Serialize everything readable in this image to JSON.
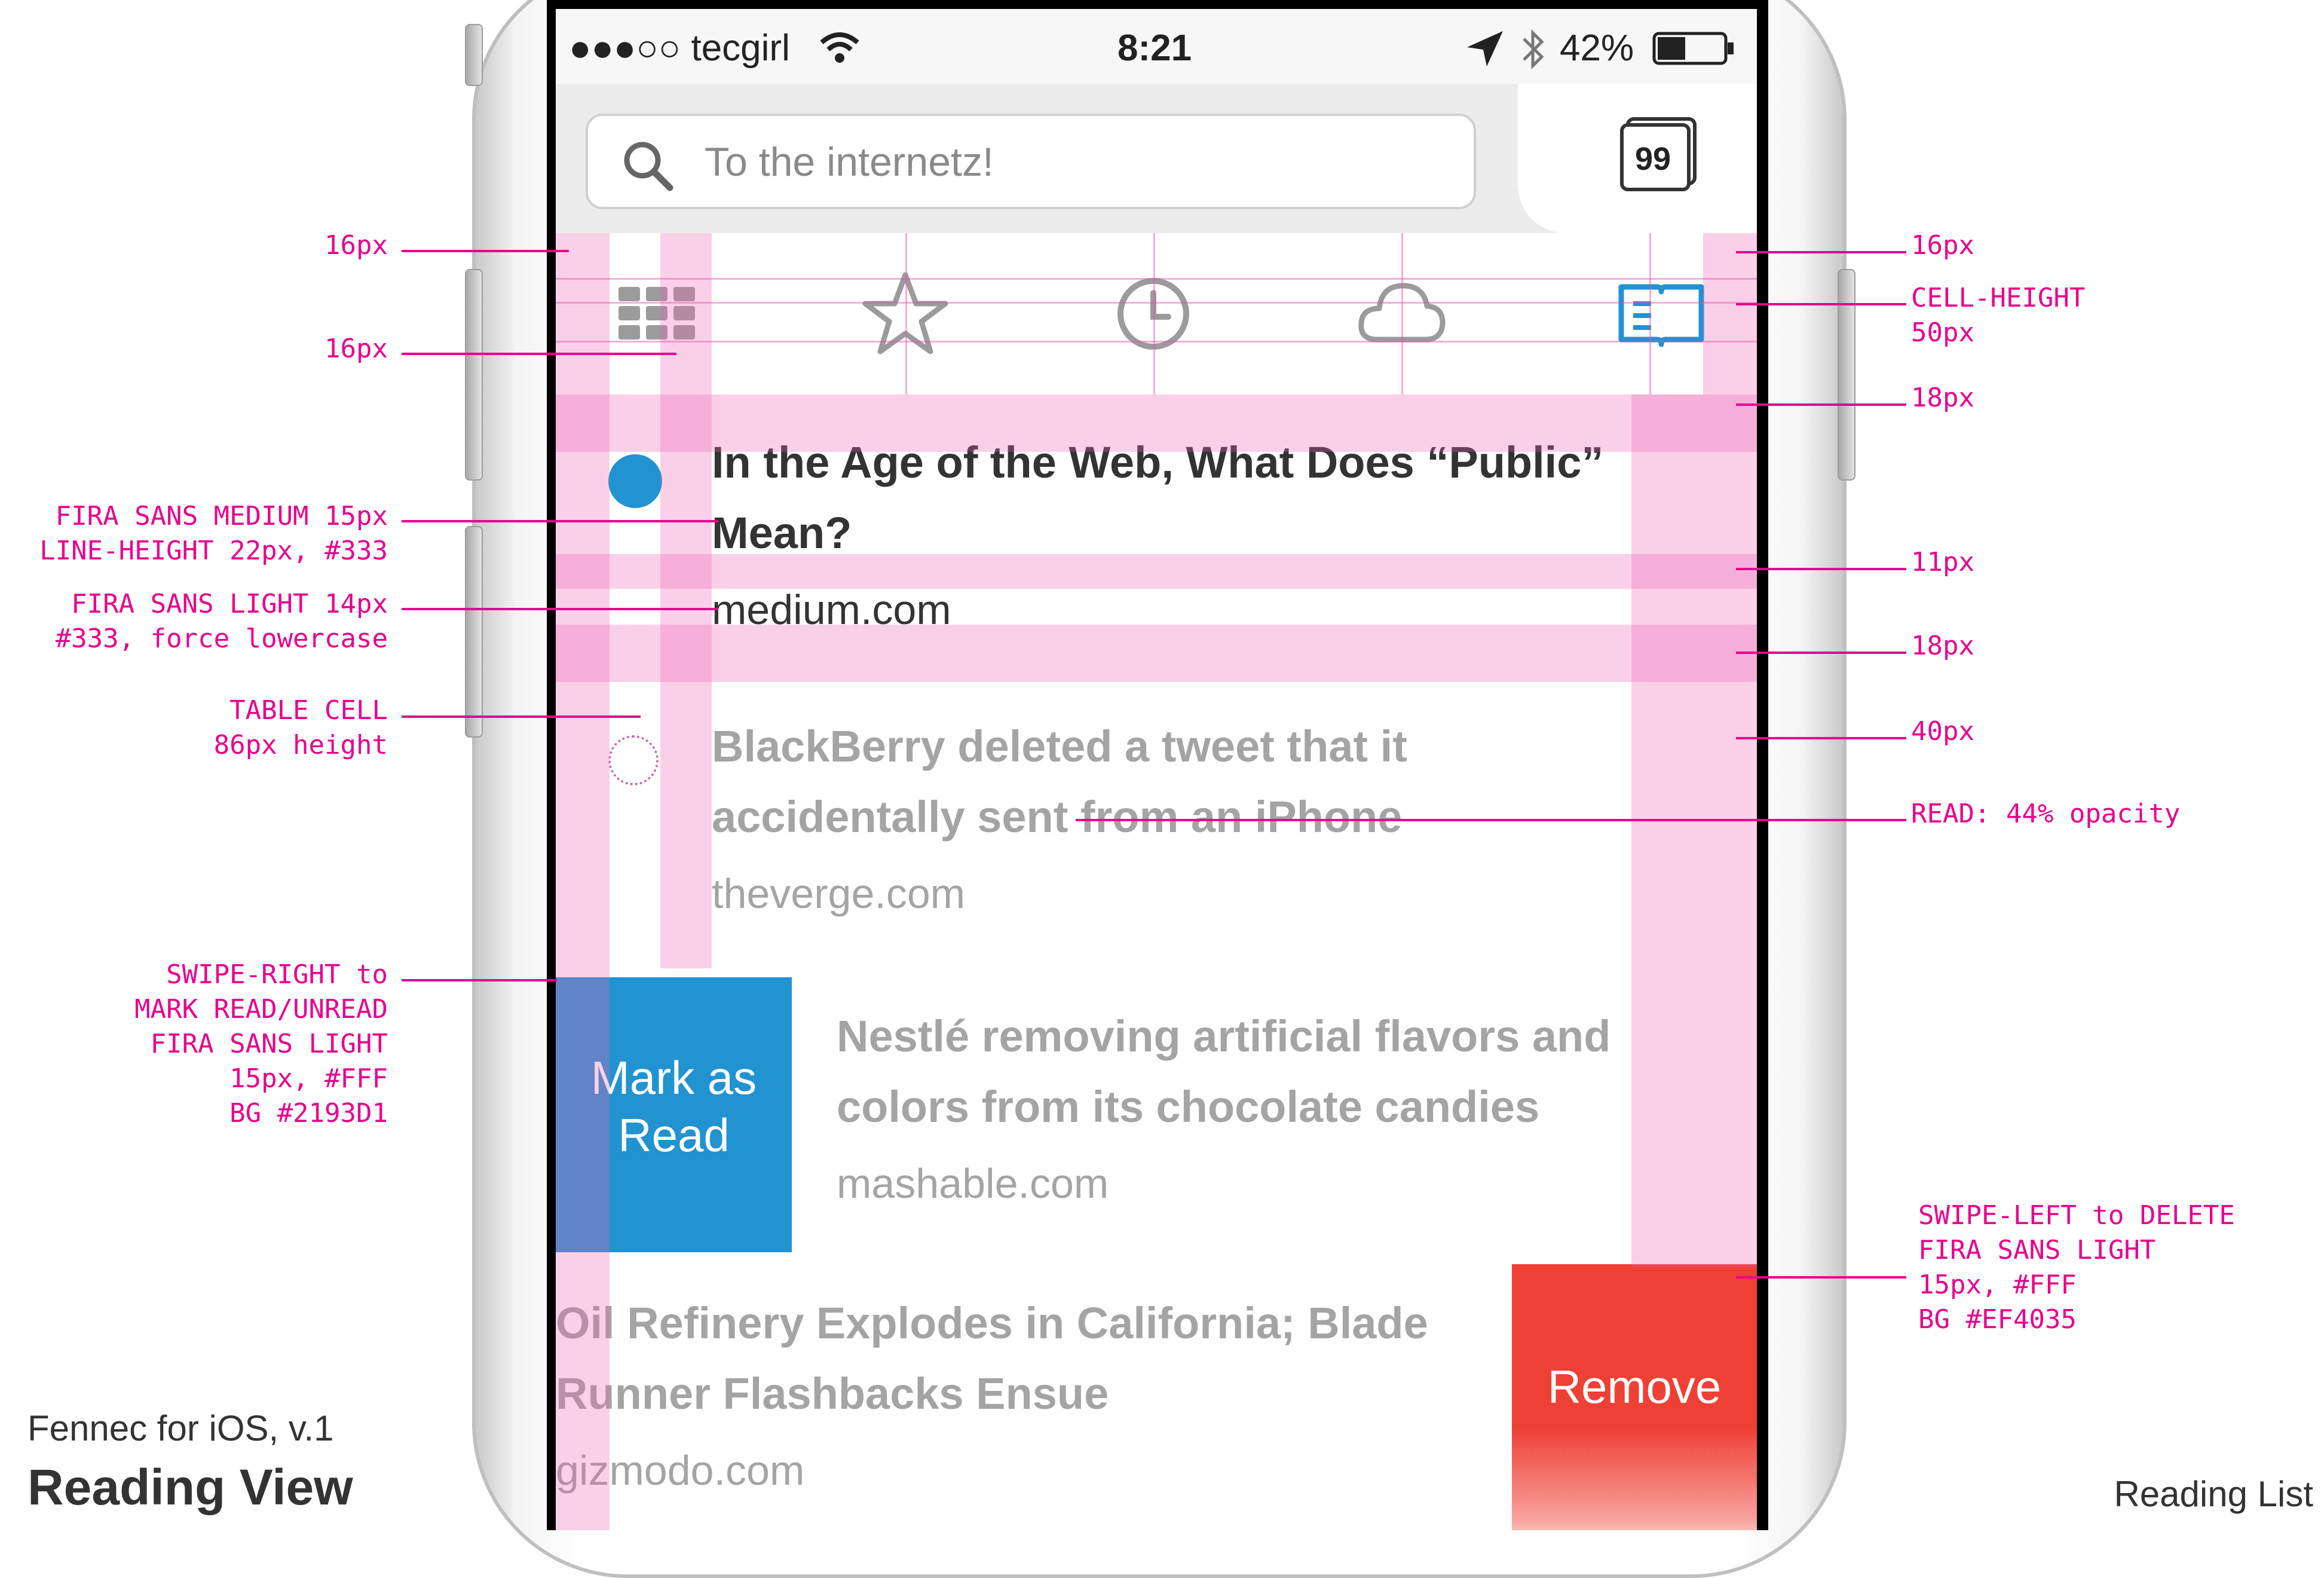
{
  "status_bar": {
    "carrier": "●●●○○ tecgirl",
    "time": "8:21",
    "battery": "42%",
    "icons": [
      "wifi-icon",
      "location-icon",
      "bluetooth-icon",
      "battery-icon"
    ]
  },
  "url_bar": {
    "placeholder": "To the internetz!",
    "tab_count": "99",
    "icons": [
      "search-icon",
      "tabs-icon"
    ]
  },
  "toolbar": {
    "icons": [
      "top-sites-grid-icon",
      "bookmarks-star-icon",
      "history-clock-icon",
      "synced-cloud-icon",
      "reading-list-book-icon"
    ],
    "active": "reading-list-book-icon",
    "active_color": "#2193D1",
    "inactive_color": "#9b9b9b"
  },
  "reading_list": [
    {
      "title": "In the Age of the Web, What Does “Public” Mean?",
      "domain": "medium.com",
      "state": "unread"
    },
    {
      "title": "BlackBerry deleted a tweet that it accidentally sent from an iPhone",
      "domain": "theverge.com",
      "state": "read"
    },
    {
      "title": "Nestlé removing artificial flavors and colors from its chocolate candies",
      "domain": "mashable.com",
      "state": "read",
      "swipe_action": "Mark as Read"
    },
    {
      "title": "Oil Refinery Explodes in California; Blade Runner Flashbacks Ensue",
      "domain": "gizmodo.com",
      "state": "read",
      "swipe_action": "Remove"
    }
  ],
  "swipe_actions": {
    "mark_read": {
      "label": "Mark as Read",
      "color": "#2193D1"
    },
    "remove": {
      "label": "Remove",
      "color": "#EF4035"
    }
  },
  "annotations": {
    "left": [
      "16px",
      "16px",
      "FIRA SANS MEDIUM 15px\nLINE-HEIGHT 22px, #333",
      "FIRA SANS LIGHT 14px\n#333, force lowercase",
      "TABLE CELL\n86px height",
      "SWIPE-RIGHT to\nMARK READ/UNREAD\nFIRA SANS LIGHT\n15px, #FFF\nBG #2193D1"
    ],
    "right": [
      "16px",
      "CELL-HEIGHT\n50px",
      "18px",
      "11px",
      "18px",
      "40px",
      "READ: 44% opacity",
      "SWIPE-LEFT to DELETE\nFIRA SANS LIGHT\n15px, #FFF\nBG #EF4035"
    ]
  },
  "footer": {
    "app_version": "Fennec for iOS, v.1",
    "view_title": "Reading View",
    "section": "Reading List"
  },
  "colors": {
    "annotation": "#e6008c",
    "guide": "#f064b4",
    "unread_dot": "#2193D1"
  }
}
